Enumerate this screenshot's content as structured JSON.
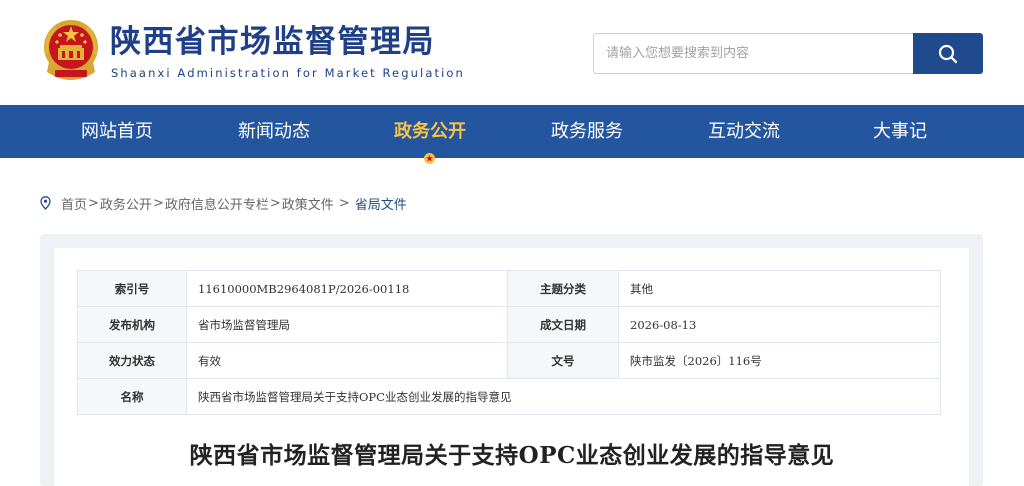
{
  "header": {
    "site_title": "陕西省市场监督管理局",
    "site_subtitle": "Shaanxi Administration for Market Regulation",
    "emblem_icon": "national-emblem-icon"
  },
  "search": {
    "placeholder": "请输入您想要搜索到内容",
    "button_icon": "search-icon"
  },
  "nav": {
    "items": [
      {
        "label": "网站首页"
      },
      {
        "label": "新闻动态"
      },
      {
        "label": "政务公开"
      },
      {
        "label": "政务服务"
      },
      {
        "label": "互动交流"
      },
      {
        "label": "大事记"
      }
    ],
    "active": "政务公开"
  },
  "breadcrumb": {
    "icon": "location-pin-icon",
    "items": [
      "首页",
      "政务公开",
      "政府信息公开专栏",
      "政策文件",
      "省局文件"
    ]
  },
  "info_table": {
    "index_label": "索引号",
    "index_value": "11610000MB2964081P/2026-00118",
    "category_label": "主题分类",
    "category_value": "其他",
    "publisher_label": "发布机构",
    "publisher_value": "省市场监督管理局",
    "date_label": "成文日期",
    "date_value": "2026-08-13",
    "status_label": "效力状态",
    "status_value": "有效",
    "docno_label": "文号",
    "docno_value": "陕市监发〔2026〕116号",
    "name_label": "名称",
    "name_value": "陕西省市场监督管理局关于支持OPC业态创业发展的指导意见"
  },
  "document": {
    "title": "陕西省市场监督管理局关于支持OPC业态创业发展的指导意见"
  },
  "colors": {
    "brand_blue": "#1f3f86",
    "nav_blue": "#2456a0",
    "nav_active": "#f6c445",
    "search_button": "#1f4b8e"
  }
}
